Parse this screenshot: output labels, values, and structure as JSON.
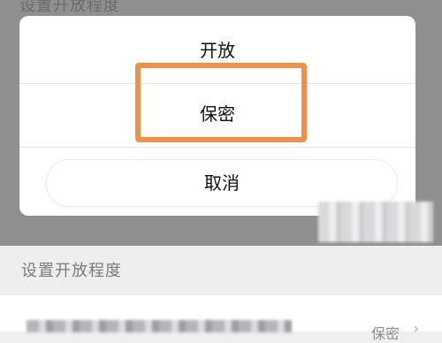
{
  "background": {
    "title": "设置开放程度"
  },
  "action_sheet": {
    "options": [
      {
        "label": "开放"
      },
      {
        "label": "保密"
      }
    ],
    "cancel_label": "取消"
  },
  "settings_row": {
    "section_title": "设置开放程度",
    "value": "保密",
    "chevron": "chevron-right-icon"
  },
  "colors": {
    "highlight": "#f0914a",
    "overlay": "#8f8f92",
    "sheet": "#ffffff"
  }
}
